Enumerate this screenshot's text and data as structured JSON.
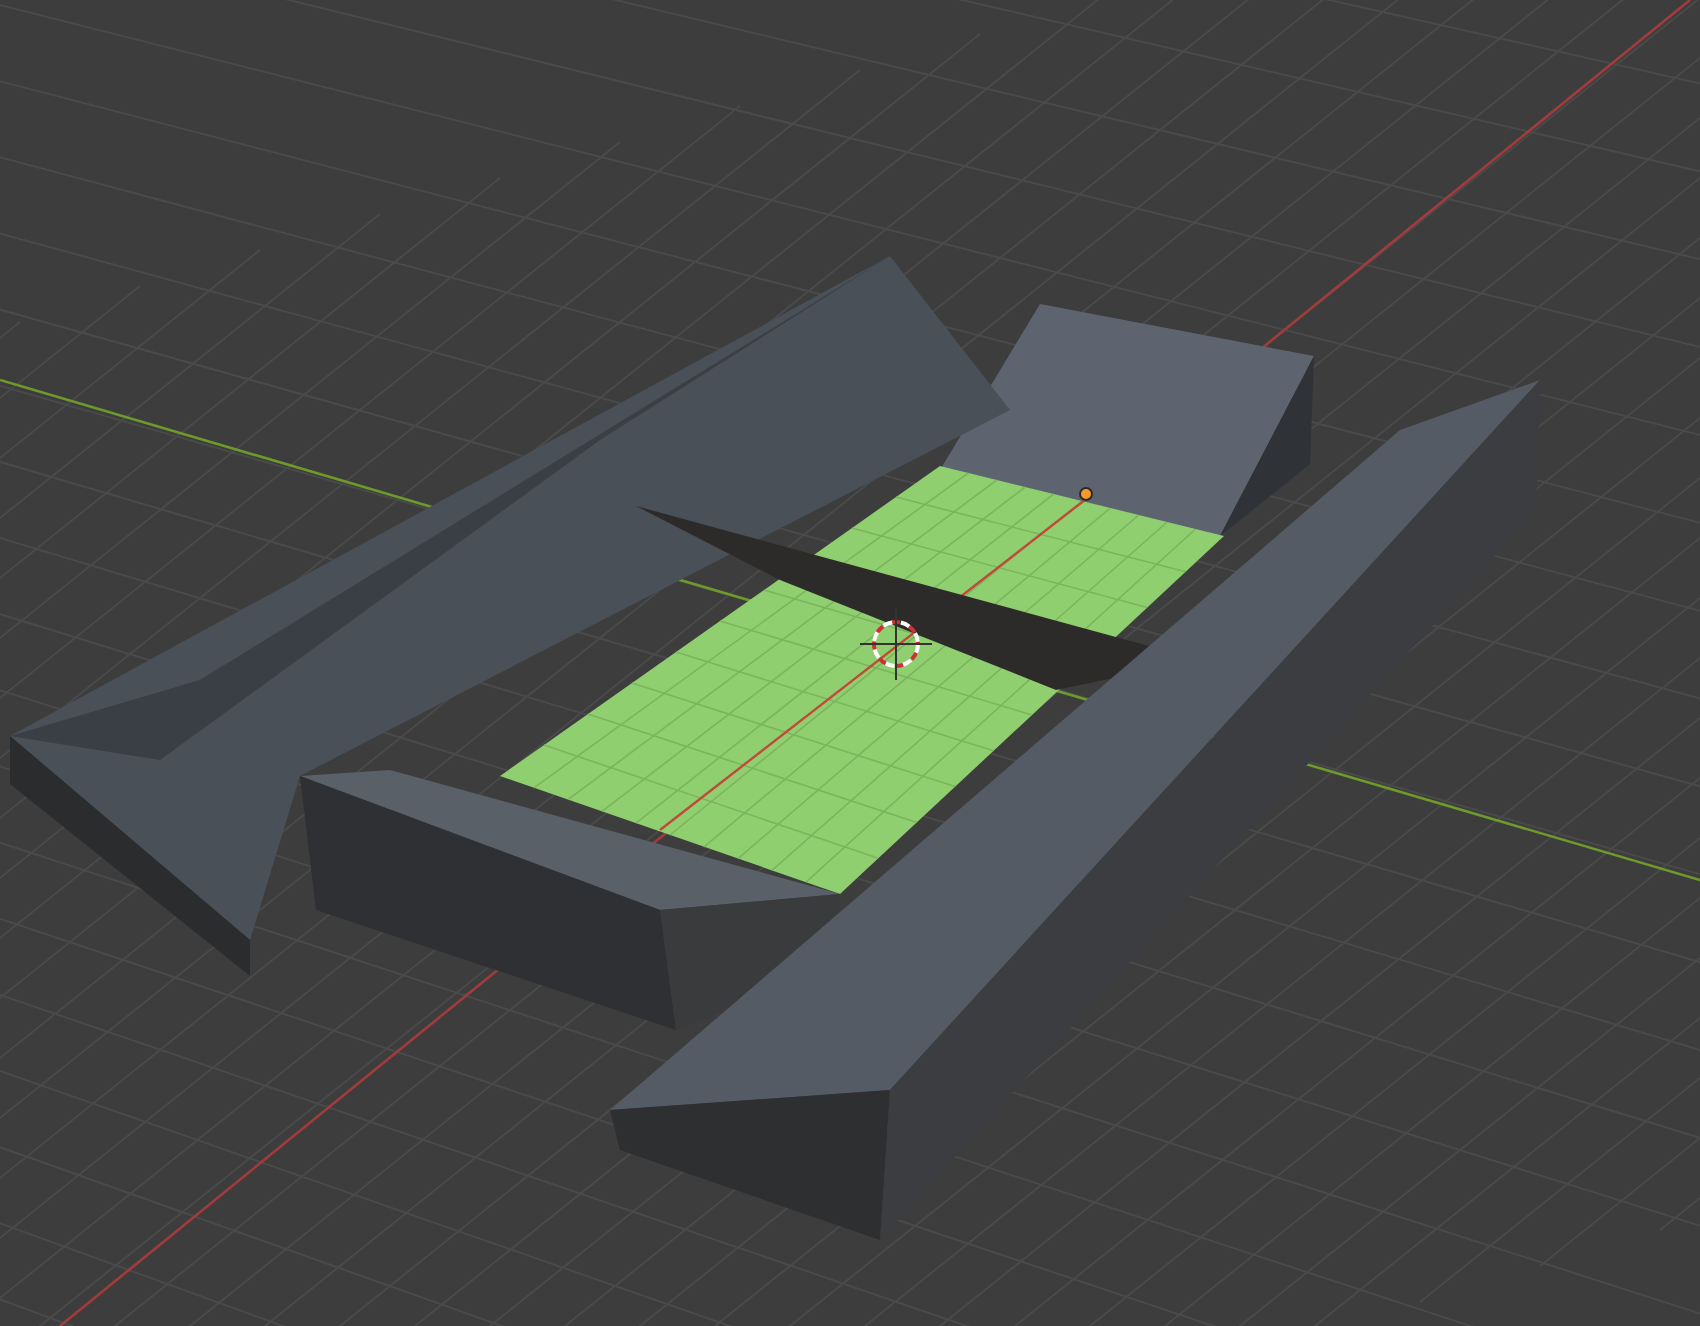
{
  "viewport": {
    "kind": "viewport"
  }
}
